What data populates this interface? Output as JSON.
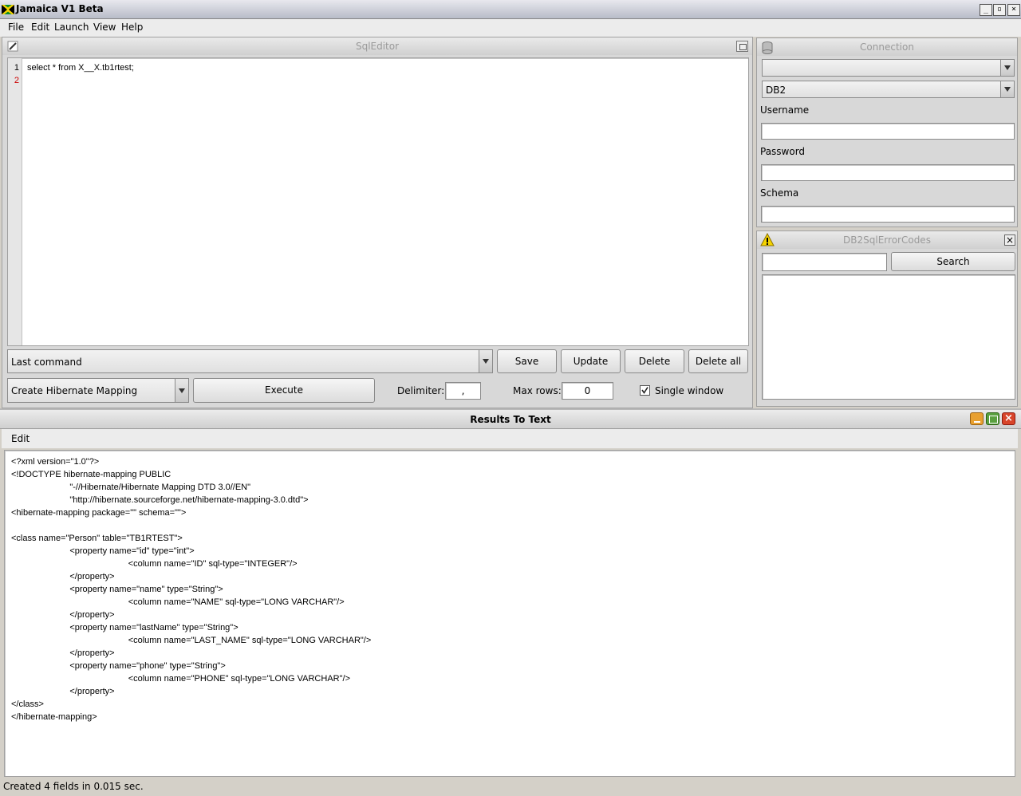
{
  "window": {
    "title": "Jamaica V1 Beta"
  },
  "menu": [
    "File",
    "Edit",
    "Launch",
    "View",
    "Help"
  ],
  "sql_editor": {
    "title": "SqlEditor",
    "line_numbers": [
      "1",
      "2"
    ],
    "code": "select * from X__X.tb1rtest;",
    "last_command_label": "Last command",
    "save_label": "Save",
    "update_label": "Update",
    "delete_label": "Delete",
    "delete_all_label": "Delete all",
    "mapping_selected": "Create Hibernate Mapping",
    "execute_label": "Execute",
    "delimiter_label": "Delimiter:",
    "delimiter_value": ",",
    "max_rows_label": "Max rows:",
    "max_rows_value": "0",
    "single_window_label": "Single window",
    "single_window_checked": true
  },
  "connection": {
    "title": "Connection",
    "connection_selected": "",
    "db_type": "DB2",
    "username_label": "Username",
    "username_value": "",
    "password_label": "Password",
    "password_value": "",
    "schema_label": "Schema",
    "schema_value": ""
  },
  "error_codes": {
    "title": "DB2SqlErrorCodes",
    "search_value": "",
    "search_label": "Search"
  },
  "results": {
    "title": "Results To Text",
    "menu_edit": "Edit",
    "lines": [
      "<?xml version=\"1.0\"?>",
      "<!DOCTYPE hibernate-mapping PUBLIC",
      "                        \"-//Hibernate/Hibernate Mapping DTD 3.0//EN\"",
      "                        \"http://hibernate.sourceforge.net/hibernate-mapping-3.0.dtd\">",
      "<hibernate-mapping package=\"\" schema=\"\">",
      "",
      "<class name=\"Person\" table=\"TB1RTEST\">",
      "                        <property name=\"id\" type=\"int\">",
      "                                                <column name=\"ID\" sql-type=\"INTEGER\"/>",
      "                        </property>",
      "                        <property name=\"name\" type=\"String\">",
      "                                                <column name=\"NAME\" sql-type=\"LONG VARCHAR\"/>",
      "                        </property>",
      "                        <property name=\"lastName\" type=\"String\">",
      "                                                <column name=\"LAST_NAME\" sql-type=\"LONG VARCHAR\"/>",
      "                        </property>",
      "                        <property name=\"phone\" type=\"String\">",
      "                                                <column name=\"PHONE\" sql-type=\"LONG VARCHAR\"/>",
      "                        </property>",
      "</class>",
      "</hibernate-mapping>"
    ],
    "status": "Created 4 fields in 0.015 sec."
  },
  "colors": {
    "close": "#d8442a",
    "minimize": "#e8a030",
    "maximize": "#5aa040",
    "line_number_current": "#cc0000"
  }
}
